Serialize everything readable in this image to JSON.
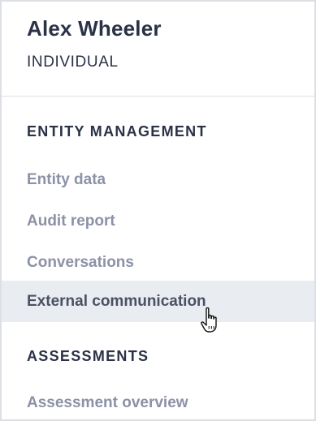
{
  "user": {
    "name": "Alex Wheeler",
    "type": "INDIVIDUAL"
  },
  "sections": [
    {
      "title": "ENTITY MANAGEMENT",
      "items": [
        {
          "label": "Entity data"
        },
        {
          "label": "Audit report"
        },
        {
          "label": "Conversations"
        },
        {
          "label": "External communication",
          "state": "hover"
        }
      ]
    },
    {
      "title": "ASSESSMENTS",
      "items": [
        {
          "label": "Assessment overview"
        }
      ]
    }
  ],
  "colors": {
    "heading_text": "#2b3246",
    "nav_text": "#8c92a6",
    "hover_background": "#e9ecf0",
    "border": "#dcdfe4"
  },
  "icons": {
    "pointer": "hand-pointer-cursor-icon"
  }
}
